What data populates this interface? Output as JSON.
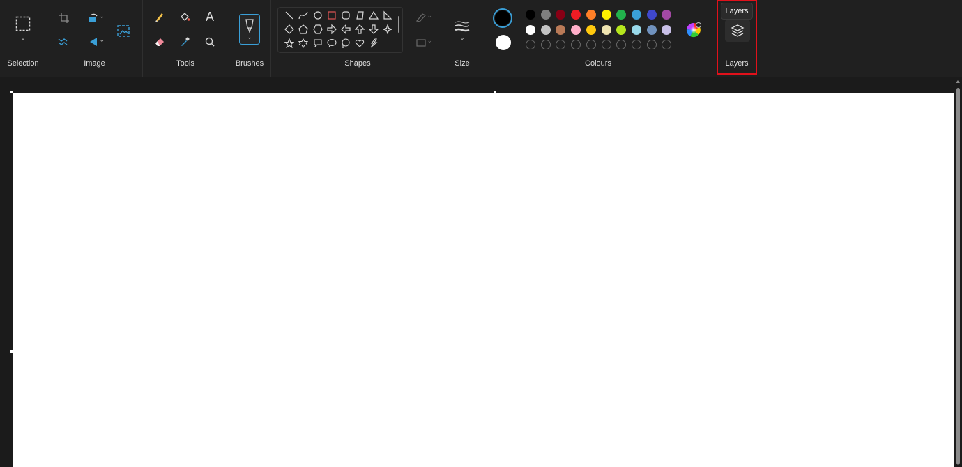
{
  "ribbon": {
    "groups": {
      "selection": "Selection",
      "image": "Image",
      "tools": "Tools",
      "brushes": "Brushes",
      "shapes": "Shapes",
      "size": "Size",
      "colours": "Colours",
      "layers": "Layers"
    },
    "layers_tooltip": "Layers"
  },
  "colours": {
    "primary": "#000000",
    "secondary": "#ffffff",
    "palette_row1": [
      "#000000",
      "#7f7f7f",
      "#880015",
      "#ed1c24",
      "#ff7f27",
      "#fff200",
      "#22b14c",
      "#3a9fd7",
      "#3f48cc",
      "#a349a4"
    ],
    "palette_row2": [
      "#ffffff",
      "#c3c3c3",
      "#b97a57",
      "#ffaec9",
      "#ffc90e",
      "#efe4b0",
      "#b5e61d",
      "#99d9ea",
      "#7092be",
      "#c8bfe7"
    ],
    "highlight": "#e0111b"
  },
  "shapes": {
    "items": [
      "line-icon",
      "curve-icon",
      "oval-icon",
      "rectangle-icon",
      "rounded-rectangle-icon",
      "polygon-icon",
      "triangle-icon",
      "right-triangle-icon",
      "diamond-icon",
      "pentagon-icon",
      "hexagon-icon",
      "right-arrow-icon",
      "left-arrow-icon",
      "up-arrow-icon",
      "down-arrow-icon",
      "four-point-star-icon",
      "five-point-star-icon",
      "six-point-star-icon",
      "rounded-callout-icon",
      "oval-callout-icon",
      "cloud-callout-icon",
      "heart-icon",
      "lightning-icon"
    ]
  }
}
